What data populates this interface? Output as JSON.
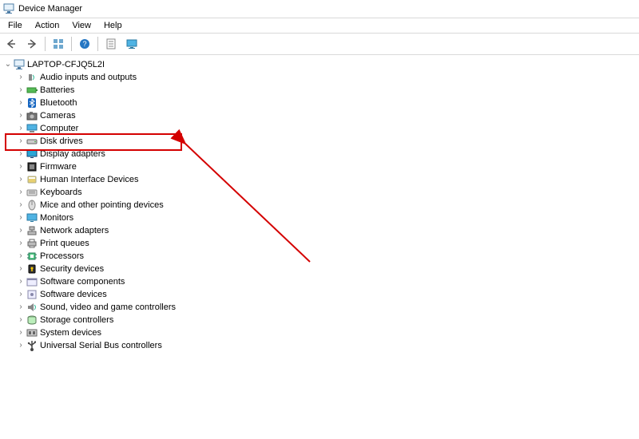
{
  "window": {
    "title": "Device Manager"
  },
  "menu": {
    "items": [
      "File",
      "Action",
      "View",
      "Help"
    ]
  },
  "toolbar": {
    "back": "back-icon",
    "forward": "forward-icon",
    "show_hidden": "show-hidden-icon",
    "help": "help-icon",
    "properties": "properties-icon",
    "monitor": "monitor-icon"
  },
  "tree": {
    "root": {
      "label": "LAPTOP-CFJQ5L2I",
      "expanded": true
    },
    "children": [
      {
        "label": "Audio inputs and outputs",
        "icon": "audio-icon"
      },
      {
        "label": "Batteries",
        "icon": "battery-icon"
      },
      {
        "label": "Bluetooth",
        "icon": "bluetooth-icon"
      },
      {
        "label": "Cameras",
        "icon": "camera-icon"
      },
      {
        "label": "Computer",
        "icon": "computer-icon"
      },
      {
        "label": "Disk drives",
        "icon": "disk-icon",
        "highlighted": true
      },
      {
        "label": "Display adapters",
        "icon": "display-icon"
      },
      {
        "label": "Firmware",
        "icon": "firmware-icon"
      },
      {
        "label": "Human Interface Devices",
        "icon": "hid-icon"
      },
      {
        "label": "Keyboards",
        "icon": "keyboard-icon"
      },
      {
        "label": "Mice and other pointing devices",
        "icon": "mouse-icon"
      },
      {
        "label": "Monitors",
        "icon": "monitor-icon"
      },
      {
        "label": "Network adapters",
        "icon": "network-icon"
      },
      {
        "label": "Print queues",
        "icon": "printer-icon"
      },
      {
        "label": "Processors",
        "icon": "processor-icon"
      },
      {
        "label": "Security devices",
        "icon": "security-icon"
      },
      {
        "label": "Software components",
        "icon": "software-comp-icon"
      },
      {
        "label": "Software devices",
        "icon": "software-dev-icon"
      },
      {
        "label": "Sound, video and game controllers",
        "icon": "sound-icon"
      },
      {
        "label": "Storage controllers",
        "icon": "storage-icon"
      },
      {
        "label": "System devices",
        "icon": "system-icon"
      },
      {
        "label": "Universal Serial Bus controllers",
        "icon": "usb-icon"
      }
    ]
  },
  "annotation": {
    "highlight_color": "#d40000",
    "arrow_color": "#d40000"
  }
}
